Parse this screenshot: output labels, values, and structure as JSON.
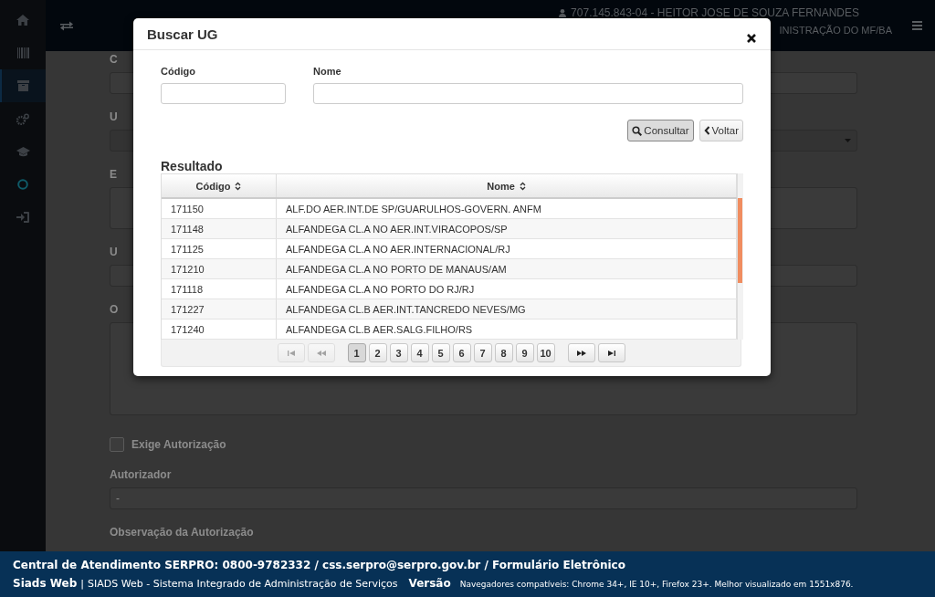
{
  "topbar": {
    "user": "707.145.843-04 - HEITOR JOSE DE SOUZA FERNANDES",
    "unit": "INISTRAÇÃO DO MF/BA"
  },
  "sidebar": {
    "items": [
      {
        "selected": false
      },
      {
        "selected": false
      },
      {
        "selected": true
      },
      {
        "selected": false
      },
      {
        "selected": false
      },
      {
        "selected": false
      },
      {
        "selected": false
      }
    ]
  },
  "form": {
    "fields": [
      {
        "label": "C",
        "kind": "input"
      },
      {
        "label": "U",
        "kind": "select"
      },
      {
        "label": "E",
        "kind": "textarea"
      },
      {
        "label": "U",
        "kind": "input"
      },
      {
        "label": "O",
        "kind": "textarea-large"
      }
    ],
    "checkbox": {
      "label": "Exige Autorização",
      "checked": false
    },
    "autorizador": {
      "label": "Autorizador",
      "value": "-"
    },
    "observacao": {
      "label": "Observação da Autorização"
    }
  },
  "modal": {
    "title": "Buscar UG",
    "filters": [
      {
        "label": "Código"
      },
      {
        "label": "Nome"
      }
    ],
    "buttons": [
      {
        "label": "Consultar",
        "pressed": true
      },
      {
        "label": "Voltar",
        "pressed": false
      }
    ],
    "result_title": "Resultado",
    "table": {
      "columns": [
        "Código",
        "Nome"
      ],
      "rows": [
        [
          "171150",
          "ALF.DO AER.INT.DE SP/GUARULHOS-GOVERN. ANFM"
        ],
        [
          "171148",
          "ALFANDEGA CL.A NO AER.INT.VIRACOPOS/SP"
        ],
        [
          "171125",
          "ALFANDEGA CL.A NO AER.INTERNACIONAL/RJ"
        ],
        [
          "171210",
          "ALFANDEGA CL.A NO PORTO DE MANAUS/AM"
        ],
        [
          "171118",
          "ALFANDEGA CL.A NO PORTO DO RJ/RJ"
        ],
        [
          "171227",
          "ALFANDEGA CL.B AER.INT.TANCREDO NEVES/MG"
        ],
        [
          "171240",
          "ALFANDEGA CL.B AER.SALG.FILHO/RS"
        ]
      ]
    },
    "pager": {
      "first": {
        "disabled": true
      },
      "prev": {
        "disabled": true
      },
      "pages": [
        {
          "label": "1",
          "selected": true
        },
        {
          "label": "2",
          "selected": false
        },
        {
          "label": "3",
          "selected": false
        },
        {
          "label": "4",
          "selected": false
        },
        {
          "label": "5",
          "selected": false
        },
        {
          "label": "6",
          "selected": false
        },
        {
          "label": "7",
          "selected": false
        },
        {
          "label": "8",
          "selected": false
        },
        {
          "label": "9",
          "selected": false
        },
        {
          "label": "10",
          "selected": false
        }
      ],
      "next": {
        "disabled": false
      },
      "last": {
        "disabled": false
      }
    }
  },
  "footer": {
    "contact": "Central de Atendimento SERPRO: 0800-9782332 / css.serpro@serpro.gov.br / Formulário Eletrônico",
    "brand": "Siads Web",
    "separator": "|",
    "system": "SIADS Web - Sistema Integrado de Administração de Serviços",
    "version": "Versão",
    "browsers": "Navegadores compatíveis: Chrome 34+, IE 10+, Firefox 23+. Melhor visualizado em 1551x876."
  }
}
